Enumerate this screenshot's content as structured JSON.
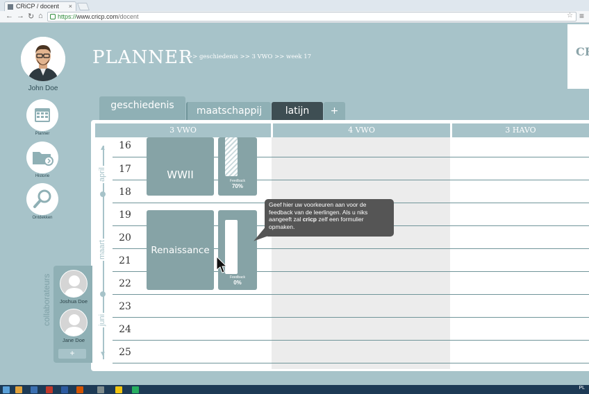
{
  "browser": {
    "tab_title": "CRiCP / docent",
    "url_https": "https://",
    "url_host": "www.cricp.com",
    "url_path": "/docent"
  },
  "user": {
    "name": "John Doe"
  },
  "sidebar": {
    "items": [
      {
        "label": "Planner",
        "icon": "calendar-icon"
      },
      {
        "label": "Historie",
        "icon": "folder-icon"
      },
      {
        "label": "Ontdekken",
        "icon": "magnifier-icon"
      }
    ]
  },
  "header": {
    "title": "PLANNER",
    "breadcrumb": ">> geschiedenis >> 3 VWO >> week 17",
    "logo_text": "CR"
  },
  "subjects": [
    {
      "label": "geschiedenis",
      "active": true
    },
    {
      "label": "maatschappij",
      "active": false
    },
    {
      "label": "latijn",
      "active": false
    },
    {
      "label": "+",
      "active": false
    }
  ],
  "columns": [
    "3 VWO",
    "4 VWO",
    "3 HAVO"
  ],
  "weeks": [
    "16",
    "17",
    "18",
    "19",
    "20",
    "21",
    "22",
    "23",
    "24",
    "25"
  ],
  "months": [
    "april",
    "maart",
    "juni"
  ],
  "blocks": [
    {
      "label": "WWII",
      "feedback_label": "Feedback",
      "feedback_pct": "70%",
      "feedback_value": 0.7
    },
    {
      "label": "Renaissance",
      "feedback_label": "Feedback",
      "feedback_pct": "0%",
      "feedback_value": 0.0
    }
  ],
  "tooltip": {
    "pre": "Geef hier uw voorkeuren aan voor de feedback van de leerlingen. Als u niks aangeeft zal ",
    "bold": "cricp",
    "post": " zelf een formulier opmaken."
  },
  "collaborators": {
    "title": "collaborateurs",
    "people": [
      "Joshua Doe",
      "Jane Doe"
    ],
    "add_label": "+"
  },
  "taskbar": {
    "lang": "PL"
  },
  "colors": {
    "background": "#a7c3c9",
    "block": "#86a3a6",
    "tab_active": "#a7c3c9",
    "tab_dark": "#3e4e53",
    "tooltip": "#555555"
  }
}
